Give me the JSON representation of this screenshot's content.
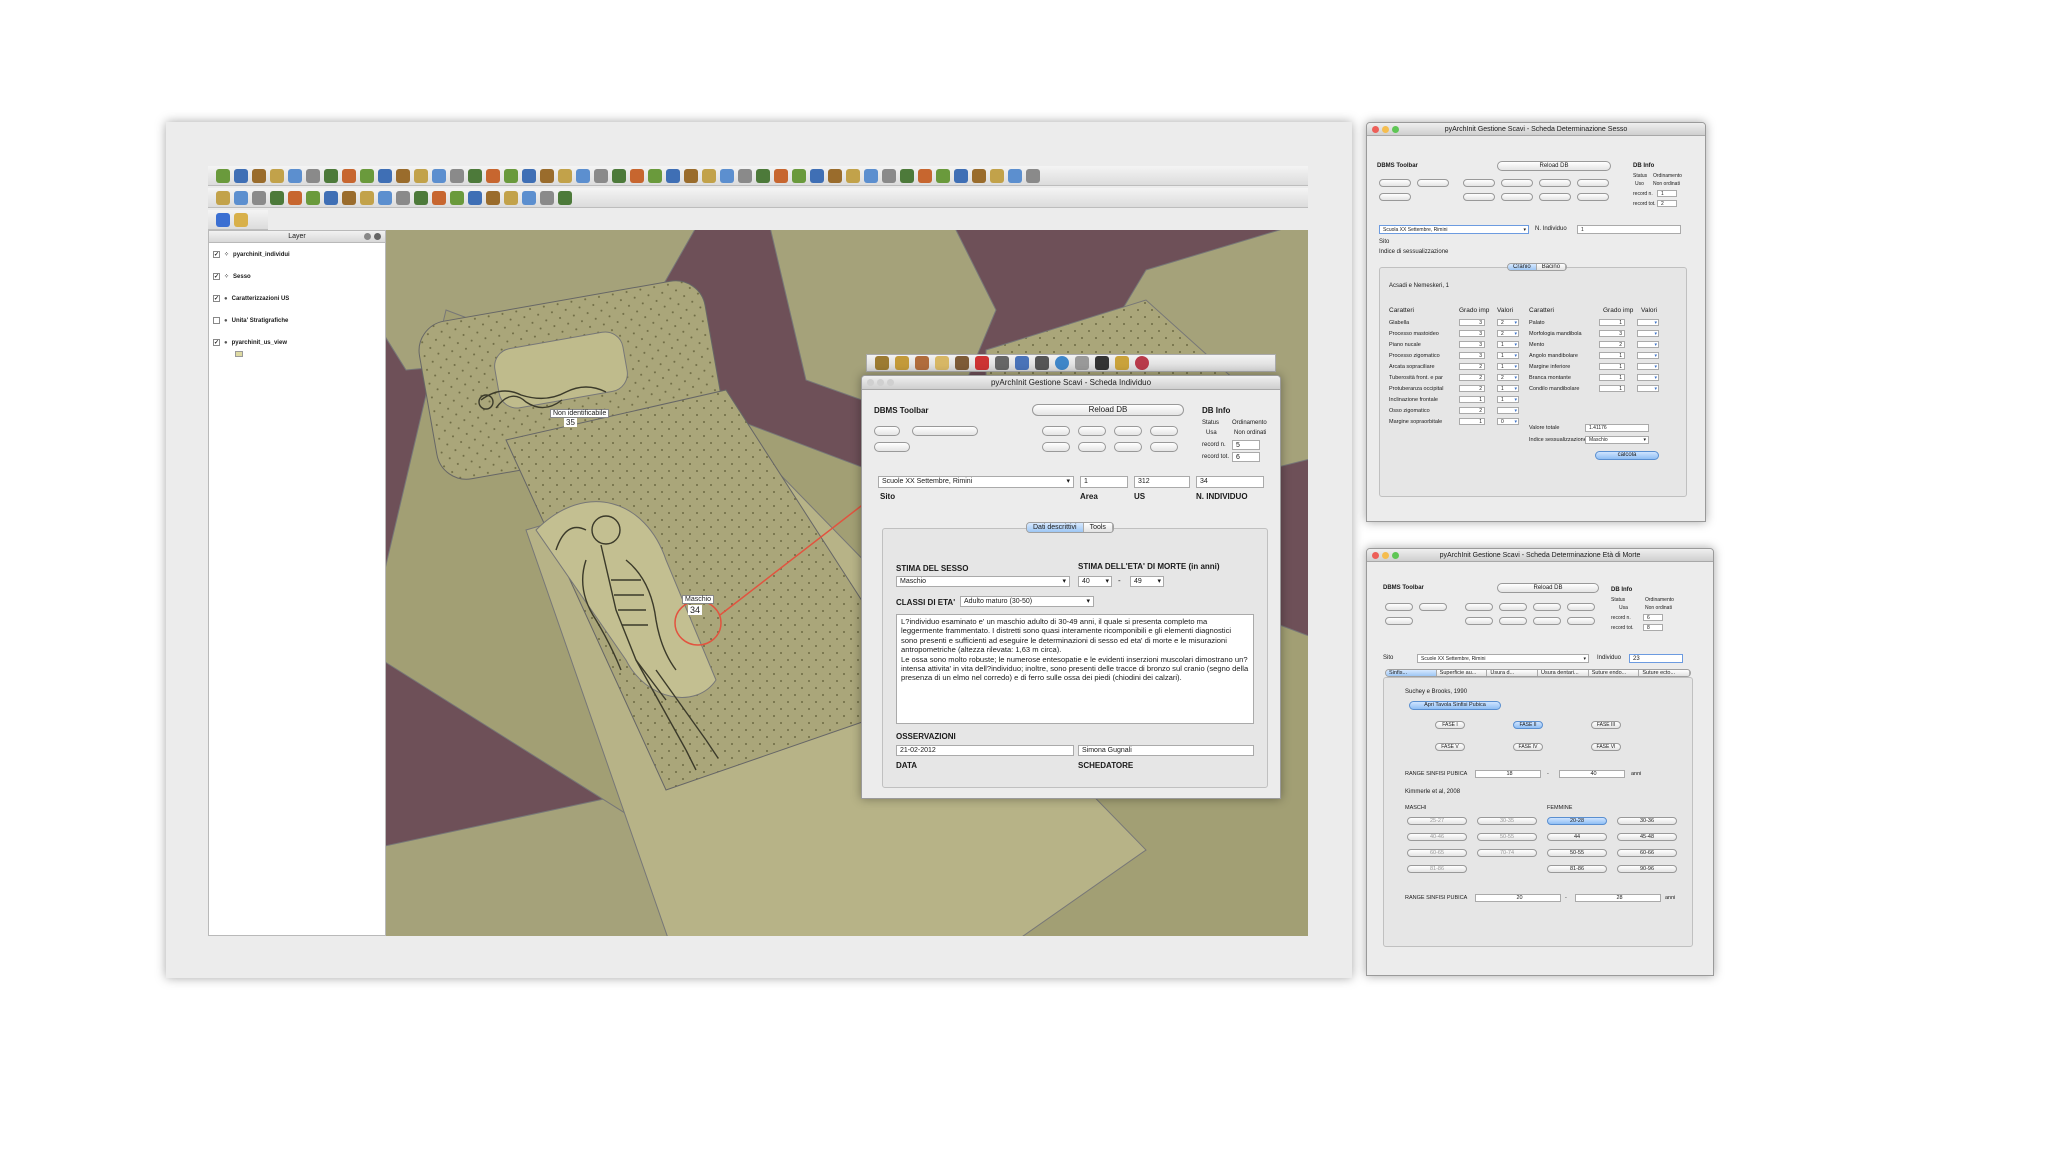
{
  "qgis": {
    "layer_panel": {
      "title": "Layer",
      "layers": [
        {
          "name": "pyarchinit_individui",
          "checked": true
        },
        {
          "name": "Sesso",
          "checked": true
        },
        {
          "name": "Caratterizzazioni US",
          "checked": true
        },
        {
          "name": "Unita' Stratigrafiche",
          "checked": false
        },
        {
          "name": "pyarchinit_us_view",
          "checked": true
        }
      ]
    },
    "map_labels": [
      {
        "text": "Non identificabile",
        "num": "35"
      },
      {
        "text": "Maschio",
        "num": "34"
      }
    ],
    "colors": {
      "background": "#6e5058",
      "polygon": "#a9a577",
      "polygon_dark": "#8f8c5e",
      "arrow": "#e2533f"
    }
  },
  "individuo": {
    "title": "pyArchInit Gestione Scavi - Scheda Individuo",
    "dbms_toolbar": "DBMS Toolbar",
    "reload_db": "Reload DB",
    "db_info": "DB Info",
    "status_label": "Status",
    "status_value": "Usa",
    "ordinamento_label": "Ordinamento",
    "ordinamento_value": "Non ordinati",
    "record_n_label": "record n.",
    "record_n": "5",
    "record_tot_label": "record tot.",
    "record_tot": "6",
    "sito_value": "Scuole XX Settembre, Rimini",
    "area_value": "1",
    "us_value": "312",
    "n_individuo_value": "34",
    "sito_label": "Sito",
    "area_label": "Area",
    "us_label": "US",
    "n_individuo_label": "N. INDIVIDUO",
    "tabs": [
      "Dati descrittivi",
      "Tools"
    ],
    "stima_sesso_label": "STIMA DEL SESSO",
    "stima_sesso_value": "Maschio",
    "stima_eta_label": "STIMA DELL'ETA' DI MORTE (in anni)",
    "eta_min": "40",
    "eta_sep": "-",
    "eta_max": "49",
    "classi_eta_label": "CLASSI DI ETA'",
    "classi_eta_value": "Adulto maturo (30-50)",
    "descrizione": "L?individuo esaminato e' un maschio adulto di 30-49 anni, il quale si presenta completo ma leggermente frammentato. I distretti sono quasi interamente ricomponibili e gli elementi diagnostici sono presenti e sufficienti ad eseguire le determinazioni di sesso ed eta' di morte e le misurazioni antropometriche (altezza rilevata: 1,63 m circa).\nLe ossa sono molto robuste; le numerose entesopatie e le evidenti inserzioni muscolari dimostrano un?intensa attivita' in vita dell?individuo; inoltre, sono presenti delle tracce di bronzo sul cranio (segno della presenza di un elmo nel corredo) e di ferro sulle ossa dei piedi (chiodini dei calzari).",
    "osservazioni_label": "OSSERVAZIONI",
    "data_value": "21-02-2012",
    "schedatore_value": "Simona Gugnali",
    "data_label": "DATA",
    "schedatore_label": "SCHEDATORE"
  },
  "sesso": {
    "title": "pyArchInit Gestione Scavi - Scheda Determinazione Sesso",
    "dbms_toolbar": "DBMS Toolbar",
    "reload_db": "Reload DB",
    "db_info": "DB Info",
    "status_label": "Status",
    "status_value": "Uso",
    "ordinamento_label": "Ordinamento",
    "ordinamento_value": "Non ordinati",
    "record_n_label": "record n.",
    "record_n": "1",
    "record_tot_label": "record tot.",
    "record_tot": "2",
    "sito_value": "Scuola XX Settembre, Rimini",
    "n_individuo_label": "N. Individuo",
    "n_individuo_value": "1",
    "sito_label": "Sito",
    "indice_label": "Indice di sessualizzazione",
    "tabs": [
      "Cranio",
      "Bacino"
    ],
    "method": "Acsadi e Nemeskeri, 1",
    "col_caratteri": "Caratteri",
    "col_grado": "Grado imp",
    "col_valori": "Valori",
    "left_rows": [
      {
        "name": "Glabella",
        "grado": "3",
        "valore": "2"
      },
      {
        "name": "Processo mastoideo",
        "grado": "3",
        "valore": "2"
      },
      {
        "name": "Piano nucale",
        "grado": "3",
        "valore": "1"
      },
      {
        "name": "Processo zigomatico",
        "grado": "3",
        "valore": "1"
      },
      {
        "name": "Arcata sopraciliare",
        "grado": "2",
        "valore": "1"
      },
      {
        "name": "Tuberosità front. e par",
        "grado": "2",
        "valore": "2"
      },
      {
        "name": "Protuberanza occipital",
        "grado": "2",
        "valore": "1"
      },
      {
        "name": "Inclinazione frontale",
        "grado": "1",
        "valore": "1"
      },
      {
        "name": "Osso zigomatico",
        "grado": "2",
        "valore": ""
      },
      {
        "name": "Margine sopraorbitale",
        "grado": "1",
        "valore": "0"
      }
    ],
    "right_rows": [
      {
        "name": "Palato",
        "grado": "1",
        "valore": ""
      },
      {
        "name": "Morfologia mandibola",
        "grado": "3",
        "valore": ""
      },
      {
        "name": "Mento",
        "grado": "2",
        "valore": ""
      },
      {
        "name": "Angolo mandibolare",
        "grado": "1",
        "valore": ""
      },
      {
        "name": "Margine inferiore",
        "grado": "1",
        "valore": ""
      },
      {
        "name": "Branca montante",
        "grado": "1",
        "valore": ""
      },
      {
        "name": "Condilo mandibolare",
        "grado": "1",
        "valore": ""
      }
    ],
    "valore_totale_label": "Valore totale",
    "valore_totale": "1.41176",
    "indice_sess_label": "Indice sessualizzazione",
    "indice_sess_value": "Maschio",
    "calcola": "calcola"
  },
  "eta": {
    "title": "pyArchInit Gestione Scavi - Scheda Determinazione Età di Morte",
    "dbms_toolbar": "DBMS Toolbar",
    "reload_db": "Reload DB",
    "db_info": "DB Info",
    "status_label": "Status",
    "status_value": "Usa",
    "ordinamento_label": "Ordinamento",
    "ordinamento_value": "Non ordinati",
    "record_n_label": "record n.",
    "record_n": "6",
    "record_tot_label": "record tot.",
    "record_tot": "8",
    "sito_label": "Sito",
    "sito_value": "Scuole XX Settembre, Rimini",
    "individuo_label": "Individuo",
    "individuo_value": "23",
    "tabs": [
      "Sinfis...",
      "Superficie au...",
      "Usura d...",
      "Usura dentari...",
      "Suture endo...",
      "Suture ecto..."
    ],
    "method1": "Suchey e Brooks, 1990",
    "apri_tavola": "Apri Tavola Sinfisi Pubica",
    "fasi": [
      "FASE I",
      "FASE II",
      "FASE III",
      "FASE V",
      "FASE IV",
      "FASE VI"
    ],
    "range_label": "RANGE SINFISI PUBICA",
    "range_min": "18",
    "range_sep": "-",
    "range_max": "40",
    "anni": "anni",
    "method2": "Kimmerle et al, 2008",
    "maschi_label": "MASCHI",
    "femmine_label": "FEMMINE",
    "maschi": [
      "25-27",
      "30-35",
      "40-46",
      "50-55",
      "60-65",
      "70-74",
      "81-86"
    ],
    "femmine": [
      "20-28",
      "30-36",
      "44",
      "45-48",
      "50-55",
      "60-66",
      "81-86",
      "90-96"
    ],
    "range2_label": "RANGE SINFISI PUBICA",
    "range2_min": "20",
    "range2_sep": "-",
    "range2_max": "28",
    "anni2": "anni"
  }
}
